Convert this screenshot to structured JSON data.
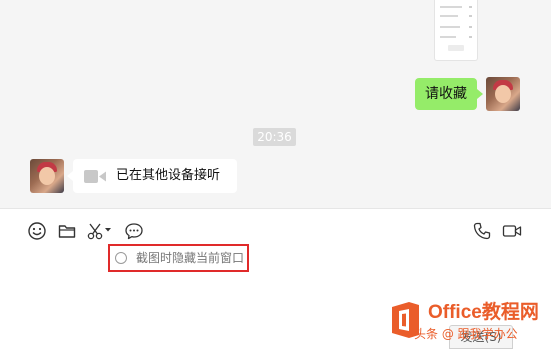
{
  "chat": {
    "messages": [
      {
        "sender": "me",
        "type": "text",
        "text": "请收藏"
      },
      {
        "sender": "system",
        "type": "timestamp",
        "text": "20:36"
      },
      {
        "sender": "other",
        "type": "call",
        "icon": "video-camera-icon",
        "text": "已在其他设备接听"
      }
    ]
  },
  "toolbar": {
    "icons": [
      "emoji-icon",
      "folder-icon",
      "scissors-icon",
      "chevron-down-icon",
      "chat-bubble-icon",
      "phone-icon",
      "video-call-icon"
    ]
  },
  "screenshot_option": {
    "label": "截图时隐藏当前窗口",
    "checked": false
  },
  "send_button": {
    "label": "发送(S)"
  },
  "watermark": {
    "brand": "Office教程网",
    "sub": "头条 @ 跟我学办公"
  },
  "colors": {
    "my_bubble": "#95ec69",
    "highlight_border": "#e02a2a",
    "watermark": "#ea5d2a"
  }
}
